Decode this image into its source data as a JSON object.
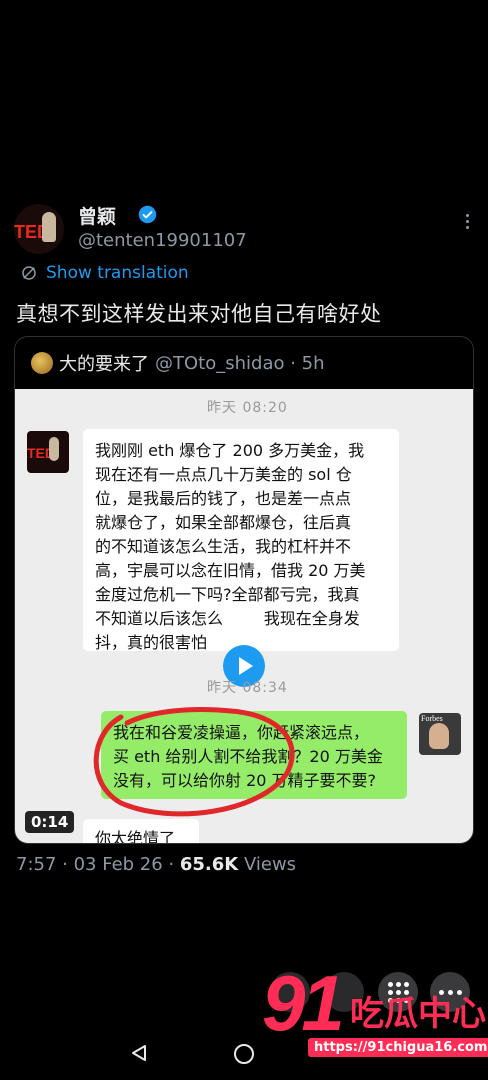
{
  "tweet": {
    "display_name": "曾颖",
    "handle": "@tenten19901107",
    "translate_label": "Show translation",
    "text": "真想不到这样发出来对他自己有啥好处",
    "meta_time": "7:57 · 03 Feb 26 · ",
    "views_count": "65.6K",
    "views_label": " Views"
  },
  "quote": {
    "name": "大的要来了",
    "handle": "@TOto_shidao · 5h"
  },
  "chat": {
    "timestamp_1": "昨天 08:20",
    "timestamp_2": "昨天 08:34",
    "message_1_lines": [
      "我刚刚 eth 爆仓了 200 多万美金，我",
      "现在还有一点点几十万美金的 sol 仓",
      "位，是我最后的钱了，也是差一点点",
      "就爆仓了，如果全部都爆仓，往后真",
      "的不知道该怎么生活，我的杠杆并不",
      "高，宇晨可以念在旧情，借我 20 万美",
      "金度过危机一下吗?全部都亏完，我真",
      "不知道以后该怎么        我现在全身发",
      "抖，真的很害怕"
    ],
    "message_2_lines": [
      "我在和谷爱凌操逼，你赶紧滚远点，",
      "买 eth 给别人割不给我割？20 万美金",
      "没有，可以给你射 20 万精子要不要?"
    ],
    "message_3": "你太绝情了",
    "video_duration": "0:14",
    "forbes_label": "Forbes"
  },
  "watermark": {
    "number": "91",
    "name": "吃瓜中心",
    "url": "https://91chigua16.com"
  },
  "colors": {
    "accent": "#1d9bf0",
    "wechat_green": "#95ec69",
    "annotation_red": "#e0282a",
    "watermark": "#ff2d55"
  },
  "icons": [
    "verified-badge-icon",
    "more-options-icon",
    "translate-icon",
    "play-icon",
    "grid-icon",
    "more-icon",
    "back-icon",
    "home-icon"
  ]
}
